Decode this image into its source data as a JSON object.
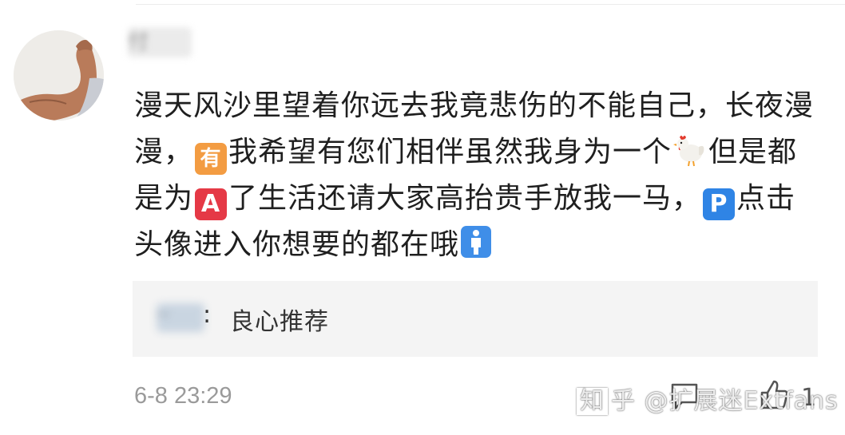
{
  "comment": {
    "author": "付",
    "text_1": "漫天风沙里望着你远去我竟悲伤的不能自己，长夜漫漫，",
    "emoji_you": "有",
    "text_2": "我希望有您们相伴虽然我身为一个",
    "emoji_chicken": "chicken-emoji",
    "text_3": "但是都是为",
    "emoji_a": "A",
    "text_4": "了生活还请大家高抬贵手放我一马，",
    "emoji_p": "P",
    "text_5": "点击头像进入你想要的都在哦",
    "emoji_man": "man-emoji"
  },
  "reply": {
    "author": "…",
    "colon": ":",
    "text": "良心推荐"
  },
  "meta": {
    "timestamp": "6-8 23:29",
    "like_count": "1"
  },
  "watermark": {
    "logo": "知",
    "text": "乎 @扩展迷Extfans"
  },
  "colors": {
    "emoji_you": "#f39c42",
    "emoji_a": "#e53946",
    "emoji_p": "#2f84e5",
    "reply_bg": "#f4f4f4",
    "timestamp": "#9a9a9a"
  }
}
